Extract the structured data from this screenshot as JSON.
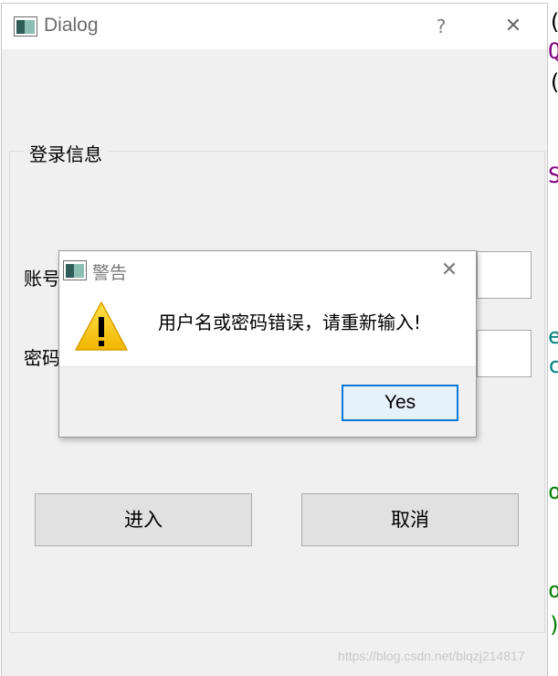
{
  "window": {
    "title": "Dialog",
    "help": "?",
    "close": "✕"
  },
  "login_group": {
    "title": "登录信息",
    "account_label": "账号",
    "password_label": "密码",
    "account_value": "",
    "password_value": ""
  },
  "buttons": {
    "enter": "进入",
    "cancel": "取消"
  },
  "message_box": {
    "title": "警告",
    "close": "✕",
    "message": "用户名或密码错误，请重新输入!",
    "icon": "warning-icon",
    "yes": "Yes"
  },
  "watermark": "https://blog.csdn.net/blqzj214817",
  "colors": {
    "accent": "#0078d7",
    "warning": "#f5c400"
  }
}
